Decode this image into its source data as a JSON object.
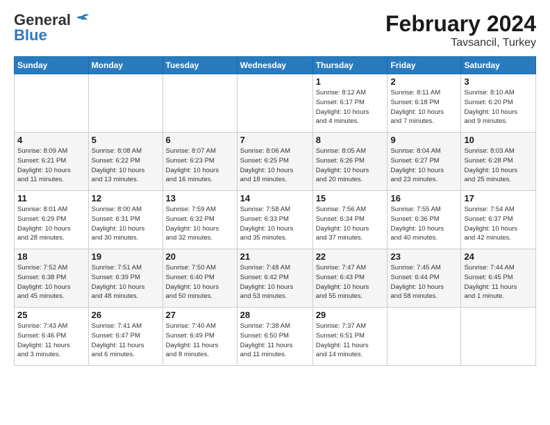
{
  "header": {
    "logo_line1": "General",
    "logo_line2": "Blue",
    "month": "February 2024",
    "location": "Tavsancil, Turkey"
  },
  "weekdays": [
    "Sunday",
    "Monday",
    "Tuesday",
    "Wednesday",
    "Thursday",
    "Friday",
    "Saturday"
  ],
  "weeks": [
    [
      {
        "day": "",
        "info": ""
      },
      {
        "day": "",
        "info": ""
      },
      {
        "day": "",
        "info": ""
      },
      {
        "day": "",
        "info": ""
      },
      {
        "day": "1",
        "info": "Sunrise: 8:12 AM\nSunset: 6:17 PM\nDaylight: 10 hours\nand 4 minutes."
      },
      {
        "day": "2",
        "info": "Sunrise: 8:11 AM\nSunset: 6:18 PM\nDaylight: 10 hours\nand 7 minutes."
      },
      {
        "day": "3",
        "info": "Sunrise: 8:10 AM\nSunset: 6:20 PM\nDaylight: 10 hours\nand 9 minutes."
      }
    ],
    [
      {
        "day": "4",
        "info": "Sunrise: 8:09 AM\nSunset: 6:21 PM\nDaylight: 10 hours\nand 11 minutes."
      },
      {
        "day": "5",
        "info": "Sunrise: 8:08 AM\nSunset: 6:22 PM\nDaylight: 10 hours\nand 13 minutes."
      },
      {
        "day": "6",
        "info": "Sunrise: 8:07 AM\nSunset: 6:23 PM\nDaylight: 10 hours\nand 16 minutes."
      },
      {
        "day": "7",
        "info": "Sunrise: 8:06 AM\nSunset: 6:25 PM\nDaylight: 10 hours\nand 18 minutes."
      },
      {
        "day": "8",
        "info": "Sunrise: 8:05 AM\nSunset: 6:26 PM\nDaylight: 10 hours\nand 20 minutes."
      },
      {
        "day": "9",
        "info": "Sunrise: 8:04 AM\nSunset: 6:27 PM\nDaylight: 10 hours\nand 23 minutes."
      },
      {
        "day": "10",
        "info": "Sunrise: 8:03 AM\nSunset: 6:28 PM\nDaylight: 10 hours\nand 25 minutes."
      }
    ],
    [
      {
        "day": "11",
        "info": "Sunrise: 8:01 AM\nSunset: 6:29 PM\nDaylight: 10 hours\nand 28 minutes."
      },
      {
        "day": "12",
        "info": "Sunrise: 8:00 AM\nSunset: 6:31 PM\nDaylight: 10 hours\nand 30 minutes."
      },
      {
        "day": "13",
        "info": "Sunrise: 7:59 AM\nSunset: 6:32 PM\nDaylight: 10 hours\nand 32 minutes."
      },
      {
        "day": "14",
        "info": "Sunrise: 7:58 AM\nSunset: 6:33 PM\nDaylight: 10 hours\nand 35 minutes."
      },
      {
        "day": "15",
        "info": "Sunrise: 7:56 AM\nSunset: 6:34 PM\nDaylight: 10 hours\nand 37 minutes."
      },
      {
        "day": "16",
        "info": "Sunrise: 7:55 AM\nSunset: 6:36 PM\nDaylight: 10 hours\nand 40 minutes."
      },
      {
        "day": "17",
        "info": "Sunrise: 7:54 AM\nSunset: 6:37 PM\nDaylight: 10 hours\nand 42 minutes."
      }
    ],
    [
      {
        "day": "18",
        "info": "Sunrise: 7:52 AM\nSunset: 6:38 PM\nDaylight: 10 hours\nand 45 minutes."
      },
      {
        "day": "19",
        "info": "Sunrise: 7:51 AM\nSunset: 6:39 PM\nDaylight: 10 hours\nand 48 minutes."
      },
      {
        "day": "20",
        "info": "Sunrise: 7:50 AM\nSunset: 6:40 PM\nDaylight: 10 hours\nand 50 minutes."
      },
      {
        "day": "21",
        "info": "Sunrise: 7:48 AM\nSunset: 6:42 PM\nDaylight: 10 hours\nand 53 minutes."
      },
      {
        "day": "22",
        "info": "Sunrise: 7:47 AM\nSunset: 6:43 PM\nDaylight: 10 hours\nand 55 minutes."
      },
      {
        "day": "23",
        "info": "Sunrise: 7:45 AM\nSunset: 6:44 PM\nDaylight: 10 hours\nand 58 minutes."
      },
      {
        "day": "24",
        "info": "Sunrise: 7:44 AM\nSunset: 6:45 PM\nDaylight: 11 hours\nand 1 minute."
      }
    ],
    [
      {
        "day": "25",
        "info": "Sunrise: 7:43 AM\nSunset: 6:46 PM\nDaylight: 11 hours\nand 3 minutes."
      },
      {
        "day": "26",
        "info": "Sunrise: 7:41 AM\nSunset: 6:47 PM\nDaylight: 11 hours\nand 6 minutes."
      },
      {
        "day": "27",
        "info": "Sunrise: 7:40 AM\nSunset: 6:49 PM\nDaylight: 11 hours\nand 8 minutes."
      },
      {
        "day": "28",
        "info": "Sunrise: 7:38 AM\nSunset: 6:50 PM\nDaylight: 11 hours\nand 11 minutes."
      },
      {
        "day": "29",
        "info": "Sunrise: 7:37 AM\nSunset: 6:51 PM\nDaylight: 11 hours\nand 14 minutes."
      },
      {
        "day": "",
        "info": ""
      },
      {
        "day": "",
        "info": ""
      }
    ]
  ]
}
